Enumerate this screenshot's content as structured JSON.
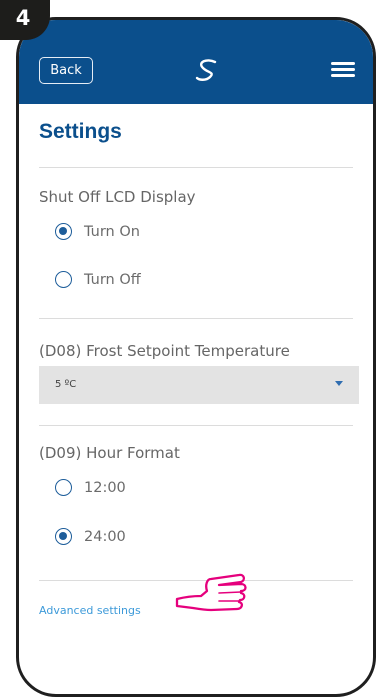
{
  "step": {
    "number": "4"
  },
  "header": {
    "back_label": "Back",
    "logo_icon": "salus-swirl-icon",
    "menu_icon": "hamburger-menu-icon",
    "bg_color": "#0b4f8c"
  },
  "page": {
    "title": "Settings"
  },
  "lcd": {
    "label": "Shut Off LCD Display",
    "options": [
      {
        "label": "Turn On",
        "checked": true
      },
      {
        "label": "Turn Off",
        "checked": false
      }
    ]
  },
  "frost": {
    "label": "(D08) Frost Setpoint Temperature",
    "selected_value": "5 ºC"
  },
  "hour_format": {
    "label": "(D09) Hour Format",
    "options": [
      {
        "label": "12:00",
        "checked": false
      },
      {
        "label": "24:00",
        "checked": true
      }
    ]
  },
  "advanced": {
    "link_label": "Advanced settings",
    "pointer_icon": "pointing-hand-icon"
  },
  "colors": {
    "accent": "#1d5d9a",
    "link": "#3d9ad9",
    "title": "#0b4f8c"
  }
}
